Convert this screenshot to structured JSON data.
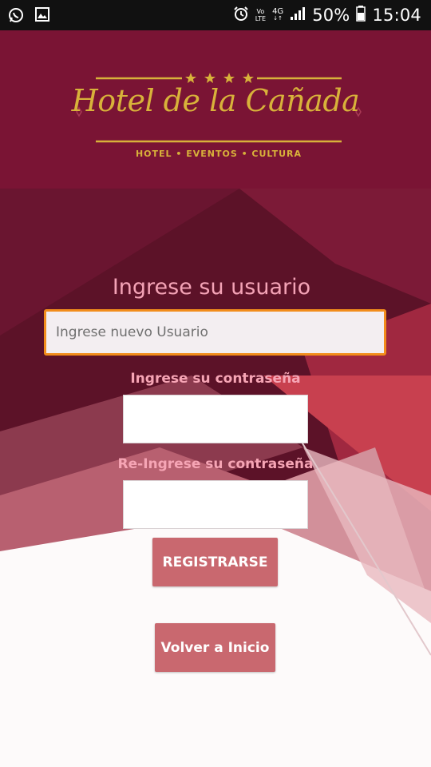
{
  "status_bar": {
    "left_icons": [
      "whatsapp-icon",
      "image-icon"
    ],
    "volte_top": "Vo",
    "volte_bottom": "LTE",
    "network": "4G",
    "battery_percent": "50%",
    "time": "15:04"
  },
  "header": {
    "logo_title": "Hotel de la Cañada",
    "logo_subtitle": "HOTEL • EVENTOS • CULTURA",
    "stars": 4,
    "background_color": "#7a1434",
    "gold_color": "#d8b23a"
  },
  "form": {
    "title": "Ingrese su usuario",
    "username_placeholder": "Ingrese nuevo Usuario",
    "username_value": "",
    "password_label": "Ingrese su contraseña",
    "password_value": "",
    "repassword_label": "Re-Ingrese su contraseña",
    "repassword_value": "",
    "register_button": "REGISTRARSE",
    "back_button": "Volver a Inicio"
  },
  "colors": {
    "accent_border": "#f28d1c",
    "label_pink": "#f4a3b6",
    "button": "#c9686f"
  }
}
